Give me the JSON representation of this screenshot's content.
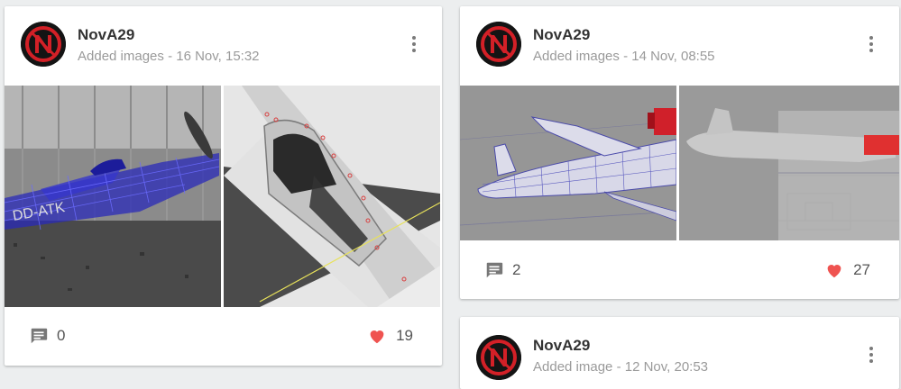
{
  "colors": {
    "heart": "#ef5350",
    "text_muted": "#9a9a9a",
    "author": "#333333"
  },
  "posts": [
    {
      "author": "NovA29",
      "subtitle": "Added images - 16 Nov, 15:32",
      "comments": "0",
      "likes": "19",
      "icons": {
        "avatar": "nova-logo-icon",
        "menu": "more-vertical-icon",
        "comment": "comment-icon",
        "like": "heart-icon"
      }
    },
    {
      "author": "NovA29",
      "subtitle": "Added images - 14 Nov, 08:55",
      "comments": "2",
      "likes": "27",
      "icons": {
        "avatar": "nova-logo-icon",
        "menu": "more-vertical-icon",
        "comment": "comment-icon",
        "like": "heart-icon"
      }
    },
    {
      "author": "NovA29",
      "subtitle": "Added image - 12 Nov, 20:53",
      "icons": {
        "avatar": "nova-logo-icon",
        "menu": "more-vertical-icon"
      }
    }
  ]
}
